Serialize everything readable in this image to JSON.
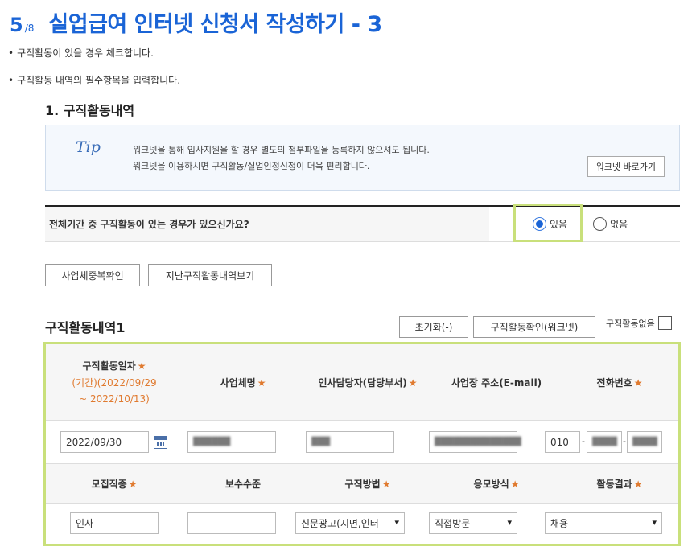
{
  "header": {
    "step": "5",
    "step_total": "/8",
    "title": "실업급여 인터넷 신청서 작성하기 - 3"
  },
  "instructions": [
    "구직활동이 있을 경우 체크합니다.",
    "구직활동 내역의 필수항목을 입력합니다."
  ],
  "section": {
    "title": "1. 구직활동내역"
  },
  "tip": {
    "label": "Tip",
    "line1": "워크넷을 통해 입사지원을 할 경우 별도의 첨부파일을 등록하지 않으셔도 됩니다.",
    "line2": "워크넷을 이용하시면 구직활동/실업인정신청이 더욱 편리합니다.",
    "button": "워크넷 바로가기"
  },
  "question": {
    "text": "전체기간 중 구직활동이 있는 경우가 있으신가요?",
    "yes_label": "있음",
    "no_label": "없음",
    "selected": "yes"
  },
  "buttons": {
    "duplicate_check": "사업체중복확인",
    "past_history": "지난구직활동내역보기",
    "reset": "초기화(-)",
    "worknet_confirm": "구직활동확인(워크넷)",
    "no_activity": "구직활동없음"
  },
  "activity": {
    "title": "구직활동내역1",
    "headers_row1": {
      "date": "구직활동일자",
      "period_line1": "(기간)(2022/09/29",
      "period_line2": "~ 2022/10/13)",
      "company": "사업체명",
      "hr_manager": "인사담당자(담당부서)",
      "address": "사업장 주소(E-mail)",
      "phone": "전화번호"
    },
    "headers_row2": {
      "position": "모집직종",
      "salary": "보수수준",
      "method": "구직방법",
      "apply_method": "응모방식",
      "result": "활동결과"
    },
    "values": {
      "date": "2022/09/30",
      "company": "██████",
      "hr_manager": "███",
      "address": "██████████████",
      "phone1": "010",
      "phone2": "████",
      "phone3": "████",
      "position": "인사",
      "salary": "",
      "method": "신문광고(지면,인터",
      "apply_method": "직접방문",
      "result": "채용"
    },
    "required_mark": "★"
  },
  "colors": {
    "title_blue": "#1a64d6",
    "required_orange": "#e07a2f",
    "highlight_green": "#c9e07b",
    "tip_bg": "#f4f8fd"
  }
}
